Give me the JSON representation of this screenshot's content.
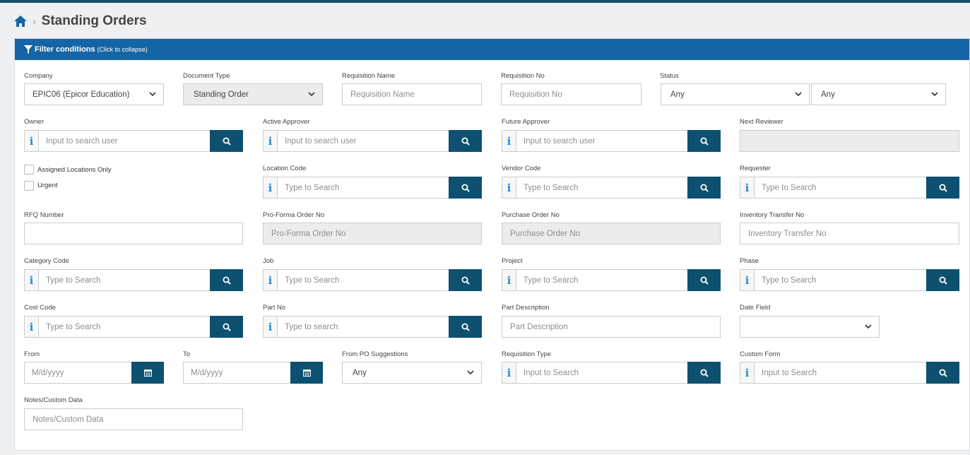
{
  "breadcrumb": {
    "title": "Standing Orders"
  },
  "filter": {
    "header_title": "Filter conditions",
    "header_hint": "(Click to collapse)"
  },
  "fields": {
    "company": {
      "label": "Company",
      "value": "EPIC06 (Epicor Education)"
    },
    "document_type": {
      "label": "Document Type",
      "value": "Standing Order"
    },
    "requisition_name": {
      "label": "Requisition Name",
      "placeholder": "Requisition Name"
    },
    "requisition_no": {
      "label": "Requisition No",
      "placeholder": "Requisition No"
    },
    "status": {
      "label": "Status",
      "value1": "Any",
      "value2": "Any"
    },
    "owner": {
      "label": "Owner",
      "placeholder": "Input to search user"
    },
    "active_approver": {
      "label": "Active Approver",
      "placeholder": "Input to search user"
    },
    "future_approver": {
      "label": "Future Approver",
      "placeholder": "Input to search user"
    },
    "next_reviewer": {
      "label": "Next Reviewer",
      "value": ""
    },
    "assigned_locations": {
      "label": "Assigned Locations Only",
      "checked": false
    },
    "urgent": {
      "label": "Urgent",
      "checked": false
    },
    "location_code": {
      "label": "Location Code",
      "placeholder": "Type to Search"
    },
    "vendor_code": {
      "label": "Vendor Code",
      "placeholder": "Type to Search"
    },
    "requester": {
      "label": "Requester",
      "placeholder": "Type to Search"
    },
    "rfq_number": {
      "label": "RFQ Number",
      "value": ""
    },
    "pro_forma_order_no": {
      "label": "Pro-Forma Order No",
      "placeholder": "Pro-Forma Order No"
    },
    "purchase_order_no": {
      "label": "Purchase Order No",
      "placeholder": "Purchase Order No"
    },
    "inventory_transfer_no": {
      "label": "Inventory Transfer No",
      "placeholder": "Inventory Transfer No"
    },
    "category_code": {
      "label": "Category Code",
      "placeholder": "Type to Search"
    },
    "job": {
      "label": "Job",
      "placeholder": "Type to Search"
    },
    "project": {
      "label": "Project",
      "placeholder": "Type to Search"
    },
    "phase": {
      "label": "Phase",
      "placeholder": "Type to Search"
    },
    "cost_code": {
      "label": "Cost Code",
      "placeholder": "Type to Search"
    },
    "part_no": {
      "label": "Part No",
      "placeholder": "Type to search"
    },
    "part_description": {
      "label": "Part Description",
      "placeholder": "Part Description"
    },
    "date_field": {
      "label": "Date Field",
      "value": ""
    },
    "from": {
      "label": "From",
      "placeholder": "M/d/yyyy"
    },
    "to": {
      "label": "To",
      "placeholder": "M/d/yyyy"
    },
    "from_po_suggestions": {
      "label": "From PO Suggestions",
      "value": "Any"
    },
    "requisition_type": {
      "label": "Requisition Type",
      "placeholder": "Input to Search"
    },
    "custom_form": {
      "label": "Custom Form",
      "placeholder": "Input to Search"
    },
    "notes_custom_data": {
      "label": "Notes/Custom Data",
      "placeholder": "Notes/Custom Data"
    }
  },
  "icons": {
    "info_glyph": "i",
    "accent": "#1565a6",
    "button": "#0d5070"
  }
}
